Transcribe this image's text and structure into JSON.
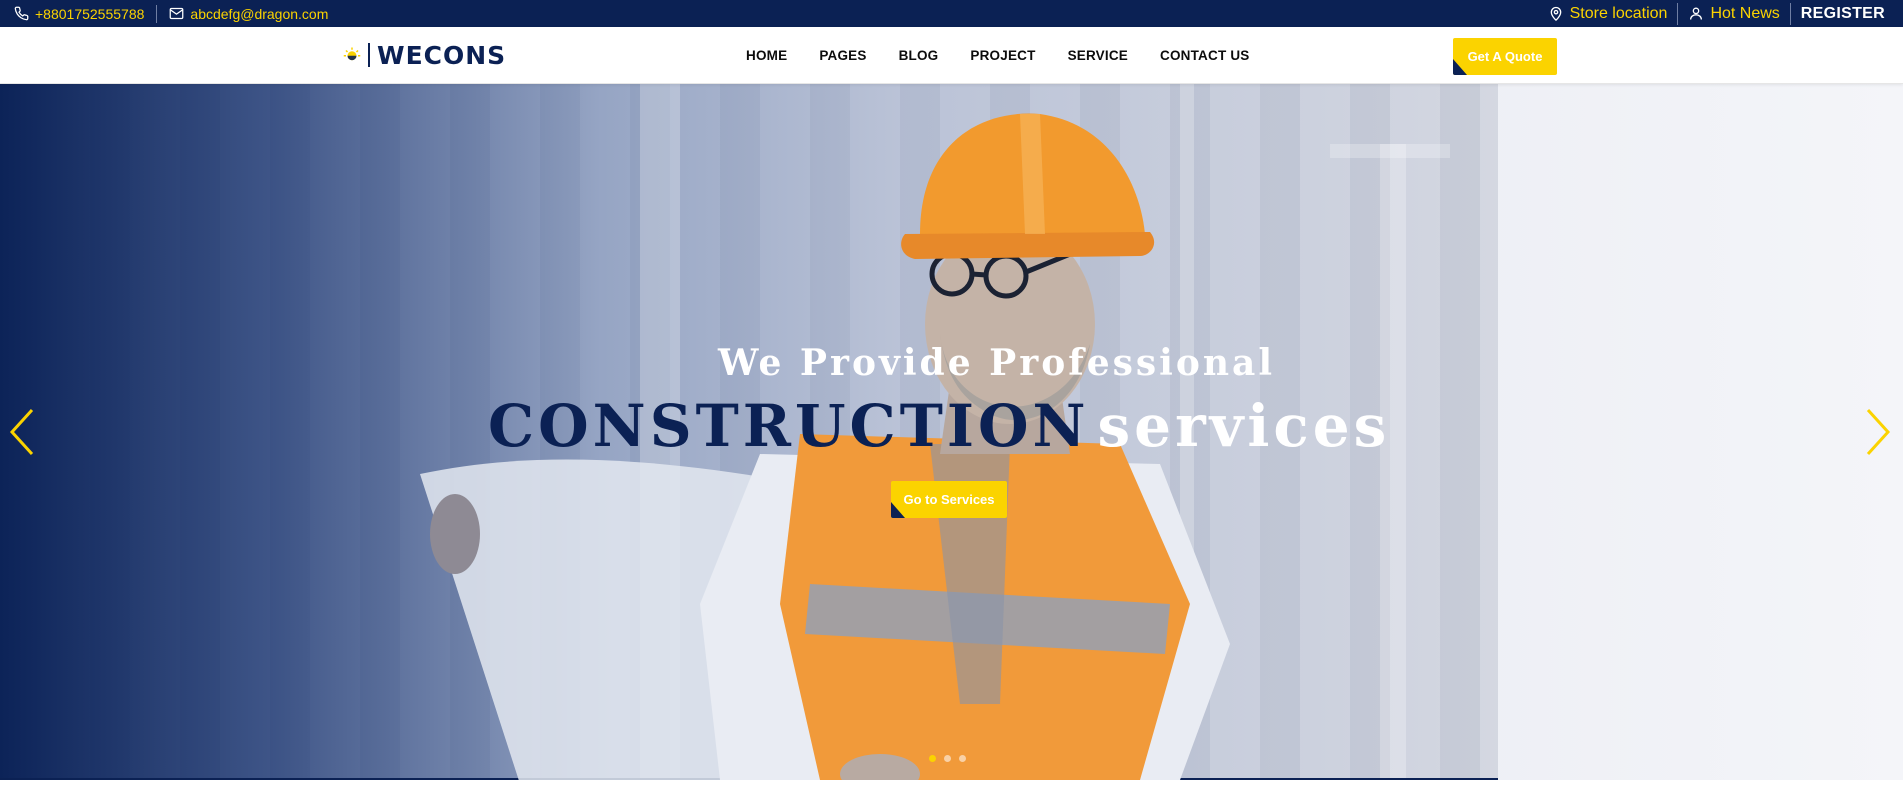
{
  "topbar": {
    "phone": "+8801752555788",
    "email": "abcdefg@dragon.com",
    "store_location": "Store location",
    "hot_news": "Hot News",
    "register": "REGISTER"
  },
  "nav": {
    "logo_text": "WECONS",
    "menu": [
      "HOME",
      "PAGES",
      "BLOG",
      "PROJECT",
      "SERVICE",
      "CONTACT US"
    ],
    "cta": "Get A Quote"
  },
  "hero": {
    "line1": "We Provide Professional",
    "line2_dark": "CONSTRUCTION",
    "line2_light": "services",
    "button": "Go to Services",
    "slide_count": 3,
    "active_slide": 1
  },
  "colors": {
    "navy": "#0b2154",
    "yellow": "#fbd300",
    "white": "#ffffff"
  },
  "icons": {
    "phone": "phone-icon",
    "email": "envelope-icon",
    "location": "map-pin-icon",
    "user": "user-icon",
    "prev": "chevron-left-icon",
    "next": "chevron-right-icon"
  }
}
